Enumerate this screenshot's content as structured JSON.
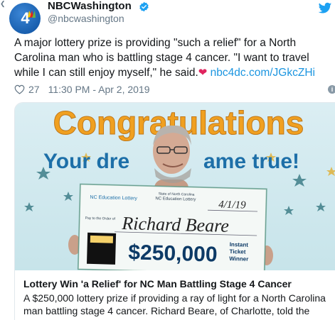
{
  "account": {
    "display_name": "NBCWashington",
    "handle": "@nbcwashington",
    "avatar_text": "4",
    "verified_icon": "verified-badge-icon",
    "brand_color": "#1da1f2"
  },
  "tweet": {
    "text_line1": "A major lottery prize is providing \"such a relief\" for a North",
    "text_line2": "Carolina man who is battling stage 4 cancer. \"I want to travel",
    "text_line3": "while I can still enjoy myself,\" he said.",
    "emoji": "❤",
    "link": "nbc4dc.com/JGkcZHi",
    "likes": "27",
    "timestamp": "11:30 PM - Apr 2, 2019"
  },
  "card": {
    "image": {
      "banner_word": "Congratulations",
      "banner_sub": "Your dre",
      "banner_sub_end": "ame true!",
      "check_logo": "NC Education Lottery",
      "check_state": "State of North Carolina",
      "check_state2": "NC Education Lottery",
      "check_date": "4/1/19",
      "check_pay_label": "Pay to the Order of",
      "check_name": "Richard Beare",
      "check_amount": "$250,000",
      "check_memo1": "Instant",
      "check_memo2": "Ticket",
      "check_memo3": "Winner"
    },
    "title": "Lottery Win 'a Relief' for NC Man Battling Stage 4 Cancer",
    "description_line1": "A $250,000 lottery prize if providing a ray of light for a North Carolina",
    "description_line2": "man battling stage 4 cancer. Richard Beare, of Charlotte, told the"
  }
}
